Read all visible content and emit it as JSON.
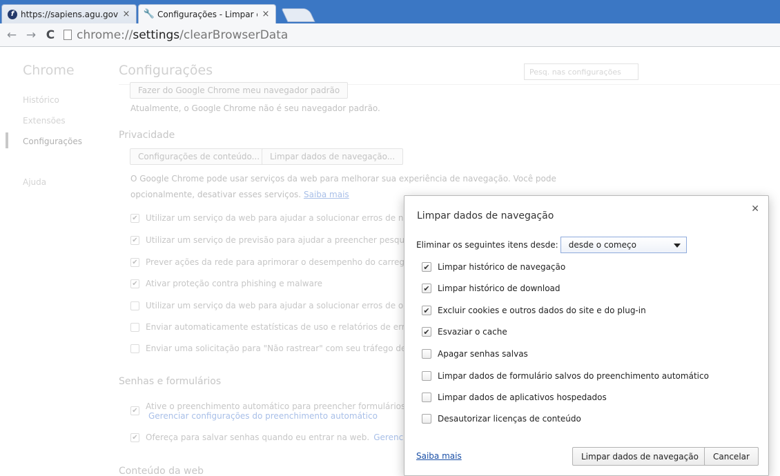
{
  "tabs": [
    {
      "title": "https://sapiens.agu.gov.br",
      "icon": "site-favicon",
      "active": false
    },
    {
      "title": "Configurações - Limpar d",
      "icon": "wrench-icon",
      "active": true
    }
  ],
  "toolbar": {
    "url_scheme": "chrome://",
    "url_host": "settings",
    "url_path": "/clearBrowserData"
  },
  "sidebar": {
    "title": "Chrome",
    "items": [
      {
        "label": "Histórico",
        "selected": false
      },
      {
        "label": "Extensões",
        "selected": false
      },
      {
        "label": "Configurações",
        "selected": true
      },
      {
        "label": "Ajuda",
        "selected": false
      }
    ]
  },
  "settings": {
    "title": "Configurações",
    "search_placeholder": "Pesq. nas configurações",
    "default_browser_button": "Fazer do Google Chrome meu navegador padrão",
    "default_browser_status": "Atualmente, o Google Chrome não é seu navegador padrão.",
    "privacy": {
      "heading": "Privacidade",
      "content_settings_button": "Configurações de conteúdo...",
      "clear_data_button": "Limpar dados de navegação...",
      "desc_line1": "O Google Chrome pode usar serviços da web para melhorar sua experiência de navegação. Você pode",
      "desc_line2": "opcionalmente, desativar esses serviços.",
      "learn_more": "Saiba mais",
      "options": [
        {
          "label": "Utilizar um serviço da web para ajudar a solucionar erros de navegação",
          "checked": true
        },
        {
          "label": "Utilizar um serviço de previsão para ajudar a preencher pesquisas e URLs",
          "checked": true
        },
        {
          "label": "Prever ações da rede para aprimorar o desempenho do carregamento",
          "checked": true
        },
        {
          "label": "Ativar proteção contra phishing e malware",
          "checked": true
        },
        {
          "label": "Utilizar um serviço da web para ajudar a solucionar erros de ortografia",
          "checked": false
        },
        {
          "label": "Enviar automaticamente estatísticas de uso e relatórios de erros ao Google",
          "checked": false
        },
        {
          "label": "Enviar uma solicitação para \"Não rastrear\" com seu tráfego de navegação",
          "checked": false
        }
      ]
    },
    "passwords": {
      "heading": "Senhas e formulários",
      "autofill_label": "Ative o preenchimento automático para preencher formulários da web",
      "autofill_link": "Gerenciar configurações do preenchimento automático",
      "save_passwords_label": "Ofereça para salvar senhas quando eu entrar na web.",
      "save_passwords_link": "Gerenciar senhas"
    },
    "web_content_heading": "Conteúdo da web"
  },
  "dialog": {
    "title": "Limpar dados de navegação",
    "range_label": "Eliminar os seguintes itens desde:",
    "range_value": "desde o começo",
    "options": [
      {
        "label": "Limpar histórico de navegação",
        "checked": true
      },
      {
        "label": "Limpar histórico de download",
        "checked": true
      },
      {
        "label": "Excluir cookies e outros dados do site e do plug-in",
        "checked": true
      },
      {
        "label": "Esvaziar o cache",
        "checked": true
      },
      {
        "label": "Apagar senhas salvas",
        "checked": false
      },
      {
        "label": "Limpar dados de formulário salvos do preenchimento automático",
        "checked": false
      },
      {
        "label": "Limpar dados de aplicativos hospedados",
        "checked": false
      },
      {
        "label": "Desautorizar licenças de conteúdo",
        "checked": false
      }
    ],
    "learn_more": "Saiba mais",
    "confirm_button": "Limpar dados de navegação",
    "cancel_button": "Cancelar"
  }
}
